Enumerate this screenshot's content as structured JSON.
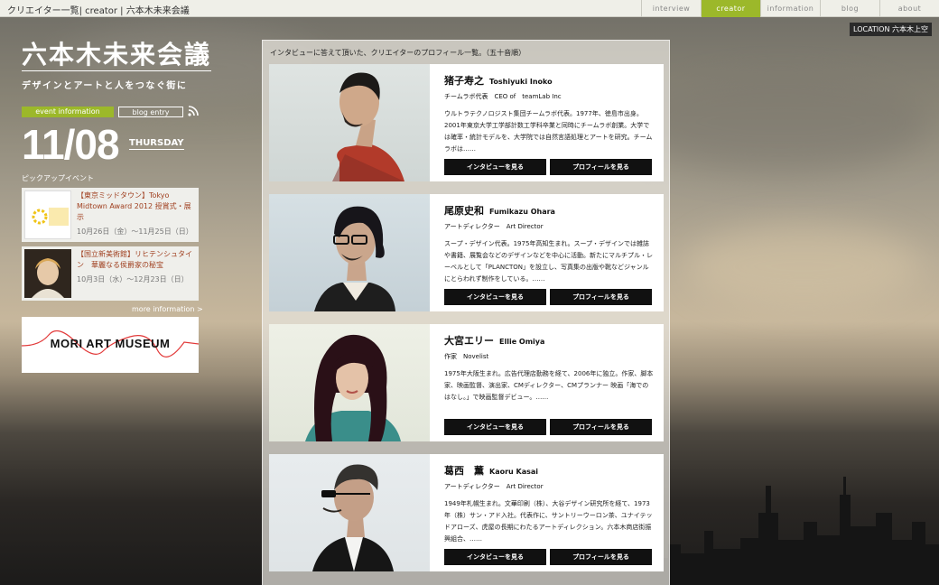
{
  "breadcrumb": [
    "クリエイター一覧| creator | 六本木未来会議"
  ],
  "nav": {
    "items": [
      "interview",
      "creator",
      "information",
      "blog",
      "about"
    ],
    "active": 1
  },
  "location": "LOCATION 六本木上空",
  "logo": {
    "title": "六本木未来会議",
    "subtitle": "デザインとアートと人をつなぐ街に"
  },
  "tabs": {
    "event": "event information",
    "blog": "blog entry"
  },
  "date": {
    "day": "11/08",
    "weekday": "THURSDAY"
  },
  "pickup_label": "ピックアップイベント",
  "events": [
    {
      "title": "【東京ミッドタウン】Tokyo Midtown Award 2012 授賞式・展示",
      "period": "10月26日（金）〜11月25日（日）",
      "thumb_text": "Tokyo Midtown Award 2012"
    },
    {
      "title": "【国立新美術館】リヒテンシュタイン　華麗なる侯爵家の秘宝",
      "period": "10月3日（水）〜12月23日（日）"
    }
  ],
  "more_link": "more information >",
  "museum_banner": "MORI ART MUSEUM",
  "intro": "インタビューに答えて頂いた、クリエイターのプロフィール一覧。（五十音順）",
  "buttons": {
    "interview": "インタビューを見る",
    "profile": "プロフィールを見る"
  },
  "creators": [
    {
      "name_ja": "猪子寿之",
      "name_en": "Toshiyuki Inoko",
      "role": "チームラボ代表　CEO of　teamLab Inc",
      "desc": "ウルトラテクノロジスト集団チームラボ代表。1977年、徳島市出身。2001年東京大学工学部計数工学科卒業と同時にチームラボ創業。大学では確率・統計モデルを、大学院では自然言語処理とアートを研究。チームラボは……"
    },
    {
      "name_ja": "尾原史和",
      "name_en": "Fumikazu Ohara",
      "role": "アートディレクター　Art Director",
      "desc": "スープ・デザイン代表。1975年高知生まれ。スープ・デザインでは雑誌や書籍、展覧会などのデザインなどを中心に活動。新たにマルチプル・レーベルとして「PLANCTON」を設立し、写真集の出版や靴などジャンルにとらわれず制作をしている。……"
    },
    {
      "name_ja": "大宮エリー",
      "name_en": "Ellie Omiya",
      "role": "作家　Novelist",
      "desc": "1975年大阪生まれ。広告代理店勤務を経て、2006年に独立。作家、脚本家、映画監督、演出家、CMディレクター、CMプランナー 映画「海でのはなし。」で映画監督デビュー。……"
    },
    {
      "name_ja": "葛西　薫",
      "name_en": "Kaoru Kasai",
      "role": "アートディレクター　Art Director",
      "desc": "1949年札幌生まれ。文華印刷（株）、大谷デザイン研究所を経て、1973年（株）サン・アド入社。代表作に、サントリーウーロン茶、ユナイテッドアローズ、虎屋の長期にわたるアートディレクション。六本木商店街振興組合、……"
    }
  ],
  "colors": {
    "accent": "#9cb82a",
    "button": "#111111"
  }
}
